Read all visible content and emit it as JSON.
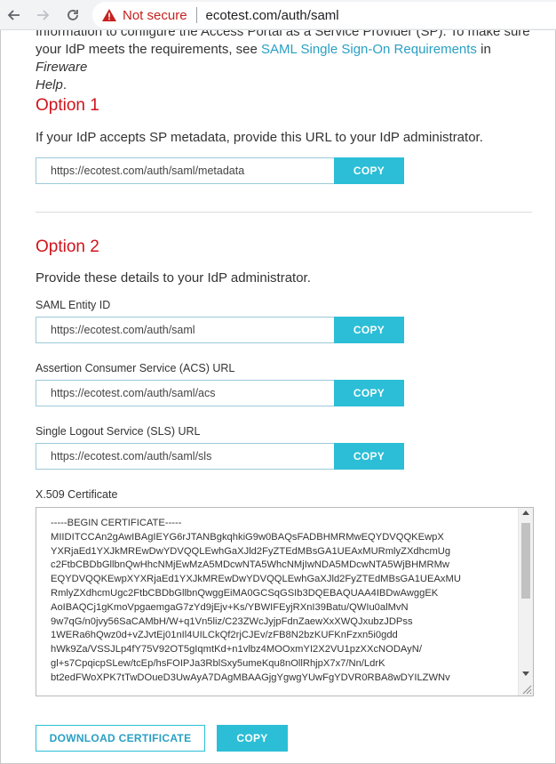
{
  "browser": {
    "back_icon": "back-arrow-icon",
    "forward_icon": "forward-arrow-icon",
    "reload_icon": "reload-icon",
    "security_label": "Not secure",
    "url": "ecotest.com/auth/saml"
  },
  "intro": {
    "line1": "Information to configure the Access Portal as a Service Provider (SP). To make sure",
    "line2_prefix": "your IdP meets the requirements, see ",
    "link": "SAML Single Sign-On Requirements",
    "line2_mid": " in ",
    "help_title_1": "Fireware",
    "help_title_2": "Help",
    "end": "."
  },
  "option1": {
    "heading": "Option 1",
    "description": "If your IdP accepts SP metadata, provide this URL to your IdP administrator.",
    "metadata_url": "https://ecotest.com/auth/saml/metadata",
    "copy_label": "COPY"
  },
  "option2": {
    "heading": "Option 2",
    "description": "Provide these details to your IdP administrator.",
    "entity_id_label": "SAML Entity ID",
    "entity_id_value": "https://ecotest.com/auth/saml",
    "acs_label": "Assertion Consumer Service (ACS) URL",
    "acs_value": "https://ecotest.com/auth/saml/acs",
    "sls_label": "Single Logout Service (SLS) URL",
    "sls_value": "https://ecotest.com/auth/saml/sls",
    "copy_label": "COPY",
    "cert_label": "X.509 Certificate",
    "cert_lines": [
      "-----BEGIN CERTIFICATE-----",
      "MIIDITCCAn2gAwIBAgIEYG6rJTANBgkqhkiG9w0BAQsFADBHMRMwEQYDVQQKEwpX",
      "YXRjaEd1YXJkMREwDwYDVQQLEwhGaXJld2FyZTEdMBsGA1UEAxMURmlyZXdhcmUg",
      "c2FtbCBDbGllbnQwHhcNMjEwMzA5MDcwNTA5WhcNMjIwNDA5MDcwNTA5WjBHMRMw",
      "EQYDVQQKEwpXYXRjaEd1YXJkMREwDwYDVQQLEwhGaXJld2FyZTEdMBsGA1UEAxMU",
      "RmlyZXdhcmUgc2FtbCBDbGllbnQwggEiMA0GCSqGSIb3DQEBAQUAA4IBDwAwggEK",
      "AoIBAQCj1gKmoVpgaemgaG7zYd9jEjv+Ks/YBWIFEyjRXnI39Batu/QWIu0alMvN",
      "9w7qG/n0jvy56SaCAMbH/W+q1Vn5liz/C23ZWcJyjpFdnZaewXxXWQJxubzJDPss",
      "1WERa6hQwz0d+vZJvtEj01nIl4UILCkQf2rjCJEv/zFB8N2bzKUFKnFzxn5i0gdd",
      "hWk9Za/VSSJLp4fY75V92OT5gIqmtKd+n1vlbz4MOOxmYI2X2VU1pzXXcNODAyN/",
      "gl+s7CpqicpSLew/tcEp/hsFOIPJa3RblSxy5umeKqu8nOllRhjpX7x7/Nn/LdrK",
      "bt2edFWoXPK7tTwDOueD3UwAyA7DAgMBAAGjgYgwgYUwFgYDVR0RBA8wDYILZWNv"
    ],
    "download_label": "DOWNLOAD CERTIFICATE",
    "copy_cert_label": "COPY"
  }
}
